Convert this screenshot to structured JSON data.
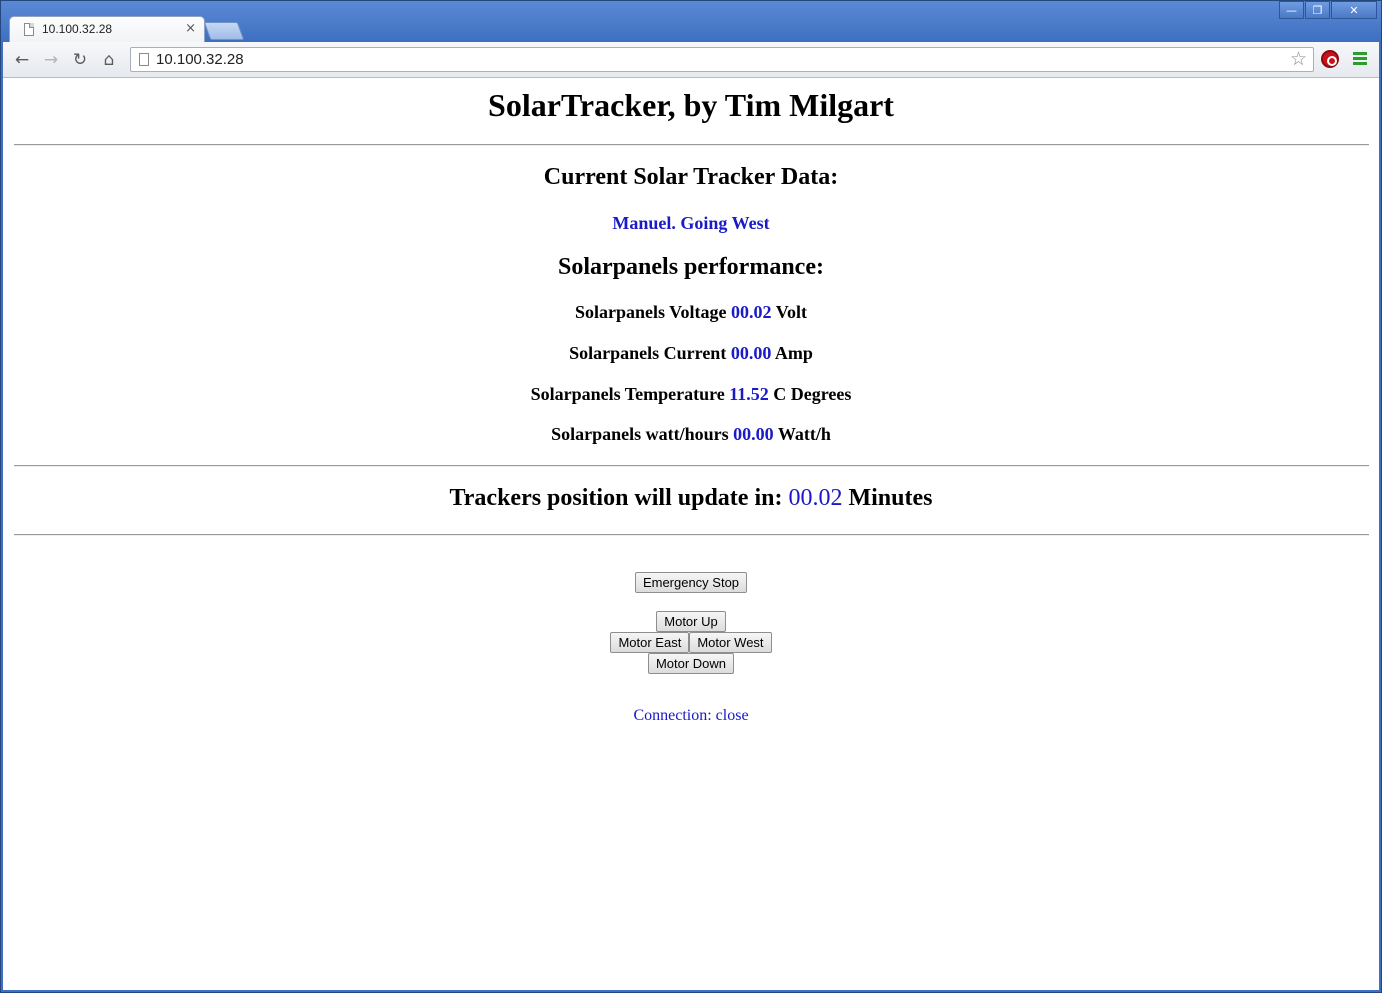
{
  "browser": {
    "tab_title": "10.100.32.28",
    "tab_close": "×",
    "url": "10.100.32.28",
    "window_controls": [
      "—",
      "❐",
      "✕"
    ],
    "nav": {
      "back": "←",
      "forward": "→",
      "reload": "↻",
      "home": "⌂"
    },
    "bookmark_star": "☆"
  },
  "page": {
    "title": "SolarTracker, by Tim Milgart",
    "current_heading": "Current Solar Tracker Data:",
    "status": "Manuel. Going West",
    "performance_heading": "Solarpanels performance:",
    "metrics": [
      {
        "label": "Solarpanels Voltage",
        "value": "00.02",
        "unit": "Volt"
      },
      {
        "label": "Solarpanels Current",
        "value": "00.00",
        "unit": "Amp"
      },
      {
        "label": "Solarpanels Temperature",
        "value": "11.52",
        "unit": "C Degrees"
      },
      {
        "label": "Solarpanels watt/hours",
        "value": "00.00",
        "unit": "Watt/h"
      }
    ],
    "update": {
      "label": "Trackers position will update in:",
      "value": "00.02",
      "unit": "Minutes"
    },
    "buttons": {
      "emergency_stop": "Emergency Stop",
      "motor_up": "Motor Up",
      "motor_east": "Motor East",
      "motor_west": "Motor West",
      "motor_down": "Motor Down"
    },
    "connection": {
      "label": "Connection:",
      "value": "close"
    }
  },
  "colors": {
    "value_blue": "#1a1ac8",
    "frame_blue": "#3f70c0"
  }
}
